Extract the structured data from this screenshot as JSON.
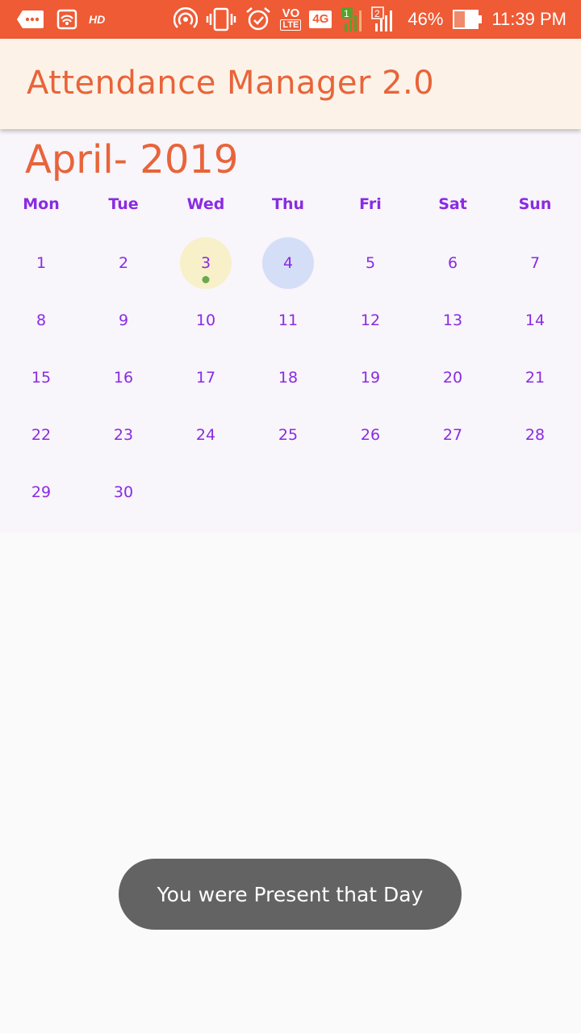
{
  "status_bar": {
    "hd_label": "HD",
    "volte_top": "VO",
    "volte_bottom": "LTE",
    "network_label": "4G",
    "sim1": "1",
    "sim2": "2",
    "battery_percent": "46%",
    "battery_level": 0.46,
    "time": "11:39 PM",
    "background_color": "#ee5b35",
    "icons": [
      "more-messages-icon",
      "nfc-icon",
      "hotspot-icon",
      "vibrate-icon",
      "alarm-icon",
      "volte-icon",
      "signal-icon",
      "battery-icon"
    ]
  },
  "app_bar": {
    "title": "Attendance Manager 2.0",
    "title_color": "#e8643a",
    "background_color": "#fcf2e7"
  },
  "calendar": {
    "month_title": "April- 2019",
    "weekdays": [
      "Mon",
      "Tue",
      "Wed",
      "Thu",
      "Fri",
      "Sat",
      "Sun"
    ],
    "leading_blanks": 0,
    "days": [
      "1",
      "2",
      "3",
      "4",
      "5",
      "6",
      "7",
      "8",
      "9",
      "10",
      "11",
      "12",
      "13",
      "14",
      "15",
      "16",
      "17",
      "18",
      "19",
      "20",
      "21",
      "22",
      "23",
      "24",
      "25",
      "26",
      "27",
      "28",
      "29",
      "30"
    ],
    "highlights": {
      "3": {
        "circle_color": "#f7f0c9",
        "dot_color": "#6aa84f",
        "state": "selected-present"
      },
      "4": {
        "circle_color": "#d5def7",
        "state": "today"
      }
    },
    "text_color": "#8a2be2"
  },
  "toast": {
    "message": "You were Present that Day"
  }
}
